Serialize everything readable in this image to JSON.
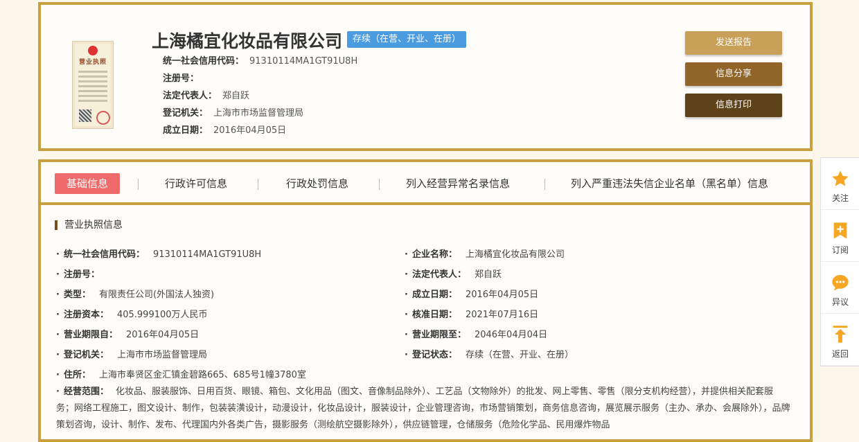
{
  "header": {
    "license_title": "营业执照",
    "company_name": "上海橘宜化妆品有限公司",
    "status_badge": "存续（在营、开业、在册）",
    "credit_code_label": "统一社会信用代码：",
    "credit_code": "91310114MA1GT91U8H",
    "reg_no_label": "注册号：",
    "reg_no": "",
    "legal_rep_label": "法定代表人：",
    "legal_rep": "郑自跃",
    "authority_label": "登记机关：",
    "authority": "上海市市场监督管理局",
    "founded_label": "成立日期：",
    "founded": "2016年04月05日"
  },
  "actions": {
    "send_report": "发送报告",
    "share": "信息分享",
    "print": "信息打印"
  },
  "tabs": [
    {
      "label": "基础信息"
    },
    {
      "label": "行政许可信息"
    },
    {
      "label": "行政处罚信息"
    },
    {
      "label": "列入经营异常名录信息"
    },
    {
      "label": "列入严重违法失信企业名单（黑名单）信息"
    }
  ],
  "section": {
    "title": "营业执照信息",
    "left": [
      {
        "label": "统一社会信用代码：",
        "value": "91310114MA1GT91U8H"
      },
      {
        "label": "注册号：",
        "value": ""
      },
      {
        "label": "类型：",
        "value": "有限责任公司(外国法人独资)"
      },
      {
        "label": "注册资本：",
        "value": "405.999100万人民币"
      },
      {
        "label": "营业期限自：",
        "value": "2016年04月05日"
      },
      {
        "label": "登记机关：",
        "value": "上海市市场监督管理局"
      },
      {
        "label": "住所：",
        "value": "上海市奉贤区金汇镇金碧路665、685号1幢3780室"
      }
    ],
    "right": [
      {
        "label": "企业名称：",
        "value": "上海橘宜化妆品有限公司"
      },
      {
        "label": "法定代表人：",
        "value": "郑自跃"
      },
      {
        "label": "成立日期：",
        "value": "2016年04月05日"
      },
      {
        "label": "核准日期：",
        "value": "2021年07月16日"
      },
      {
        "label": "营业期限至：",
        "value": "2046年04月04日"
      },
      {
        "label": "登记状态：",
        "value": "存续（在营、开业、在册）"
      }
    ],
    "scope_label": "经营范围：",
    "scope_text": "化妆品、服装服饰、日用百货、眼镜、箱包、文化用品（图文、音像制品除外）、工艺品（文物除外）的批发、网上零售、零售（限分支机构经营），并提供相关配套服务；网络工程施工，图文设计、制作，包装装潢设计，动漫设计，化妆品设计，服装设计，企业管理咨询，市场营销策划，商务信息咨询，展览展示服务（主办、承办、会展除外），品牌策划咨询，设计、制作、发布、代理国内外各类广告，摄影服务（测绘航空摄影除外），供应链管理，仓储服务（危险化学品、民用爆炸物品"
  },
  "sidebar": [
    {
      "label": "关注",
      "icon": "star-icon"
    },
    {
      "label": "订阅",
      "icon": "subscribe-icon"
    },
    {
      "label": "异议",
      "icon": "chat-icon"
    },
    {
      "label": "返回",
      "icon": "back-to-top-icon"
    }
  ],
  "colors": {
    "frame": "#c8a03f",
    "badge": "#4a9be0",
    "active_tab": "#ef6b6b",
    "icon_orange": "#f5a623"
  }
}
